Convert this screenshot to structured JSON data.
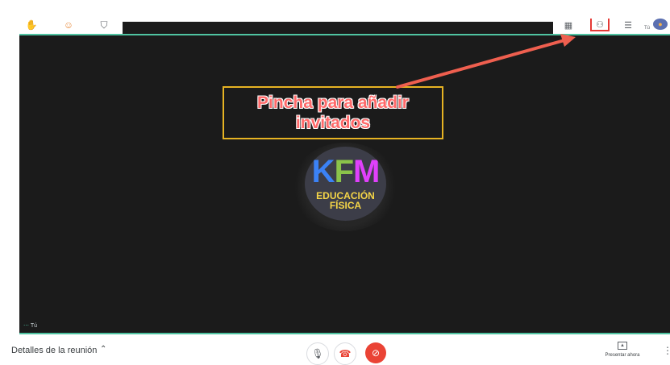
{
  "top_left_icons": [
    "raise-hand-icon",
    "emoji-activities-icon",
    "shield-icon"
  ],
  "top_right": {
    "icons": [
      "grid-layout-icon",
      "people-icon",
      "chat-icon"
    ],
    "self_label": "Tú"
  },
  "stage": {
    "callout_line1": "Pincha para añadir",
    "callout_line2": "invitados",
    "logo_letters": [
      "K",
      "F",
      "M"
    ],
    "logo_line1": "EDUCACIÓN",
    "logo_line2": "FÍSICA",
    "self_name": "Tú"
  },
  "bottom": {
    "details_label": "Detalles de la reunión",
    "present_label": "Presentar ahora"
  },
  "colors": {
    "stage_bg": "#1b1b1b",
    "accent_border": "#4fc3a1",
    "callout_border": "#e6b323",
    "callout_text": "#ff6a6a",
    "arrow": "#ef5f4f",
    "camera_off": "#ea4335"
  }
}
